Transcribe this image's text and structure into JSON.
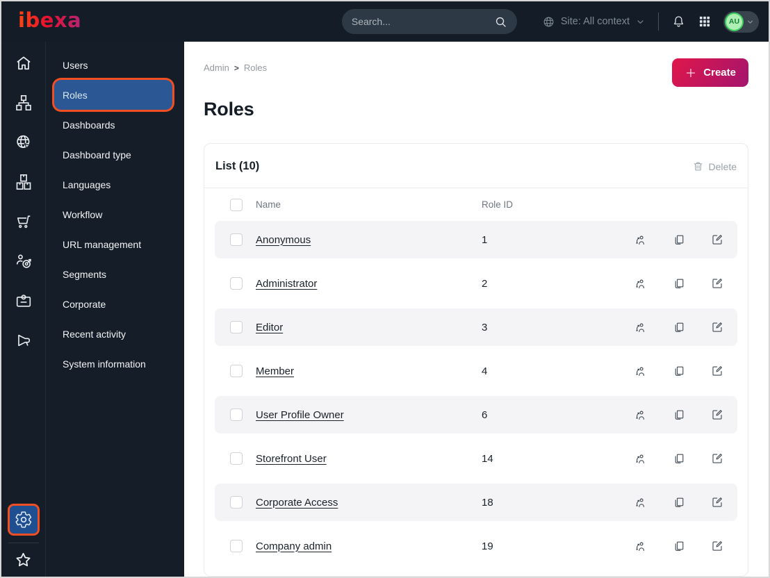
{
  "topbar": {
    "logo_text": "ibexa",
    "search_placeholder": "Search...",
    "site_selector_label": "Site: All context",
    "avatar_initials": "AU",
    "icons": [
      "globe-icon",
      "search-icon",
      "bell-icon",
      "apps-grid-icon",
      "chevron-down-icon"
    ]
  },
  "icon_rail": {
    "items": [
      "home",
      "content-structure",
      "site",
      "products",
      "commerce",
      "personalization",
      "corporate",
      "marketing"
    ],
    "bottom_items": [
      {
        "name": "admin-settings",
        "active": true
      },
      {
        "name": "bookmarks",
        "active": false
      }
    ]
  },
  "sidebar": {
    "items": [
      {
        "label": "Users",
        "active": false
      },
      {
        "label": "Roles",
        "active": true
      },
      {
        "label": "Dashboards",
        "active": false
      },
      {
        "label": "Dashboard type",
        "active": false
      },
      {
        "label": "Languages",
        "active": false
      },
      {
        "label": "Workflow",
        "active": false
      },
      {
        "label": "URL management",
        "active": false
      },
      {
        "label": "Segments",
        "active": false
      },
      {
        "label": "Corporate",
        "active": false
      },
      {
        "label": "Recent activity",
        "active": false
      },
      {
        "label": "System information",
        "active": false
      }
    ]
  },
  "main": {
    "breadcrumb": {
      "items": [
        "Admin",
        "Roles"
      ],
      "separator": ">"
    },
    "create_button_label": "Create",
    "page_title": "Roles",
    "list": {
      "title": "List (10)",
      "delete_button_label": "Delete",
      "columns": {
        "name": "Name",
        "role_id": "Role ID"
      },
      "row_action_icons": [
        "assign-users-icon",
        "copy-icon",
        "edit-icon"
      ],
      "rows": [
        {
          "name": "Anonymous",
          "id": "1"
        },
        {
          "name": "Administrator",
          "id": "2"
        },
        {
          "name": "Editor",
          "id": "3"
        },
        {
          "name": "Member",
          "id": "4"
        },
        {
          "name": "User Profile Owner",
          "id": "6"
        },
        {
          "name": "Storefront User",
          "id": "14"
        },
        {
          "name": "Corporate Access",
          "id": "18"
        },
        {
          "name": "Company admin",
          "id": "19"
        }
      ]
    }
  },
  "colors": {
    "topbar_bg": "#141d27",
    "sidebar_bg": "#151e28",
    "active_item_blue": "#2b5795",
    "annotation_orange": "#f14e22",
    "create_gradient_start": "#e0164a",
    "create_gradient_end": "#a3156e",
    "row_alt_bg": "#f4f4f6",
    "avatar_green": "#aef0b4"
  }
}
